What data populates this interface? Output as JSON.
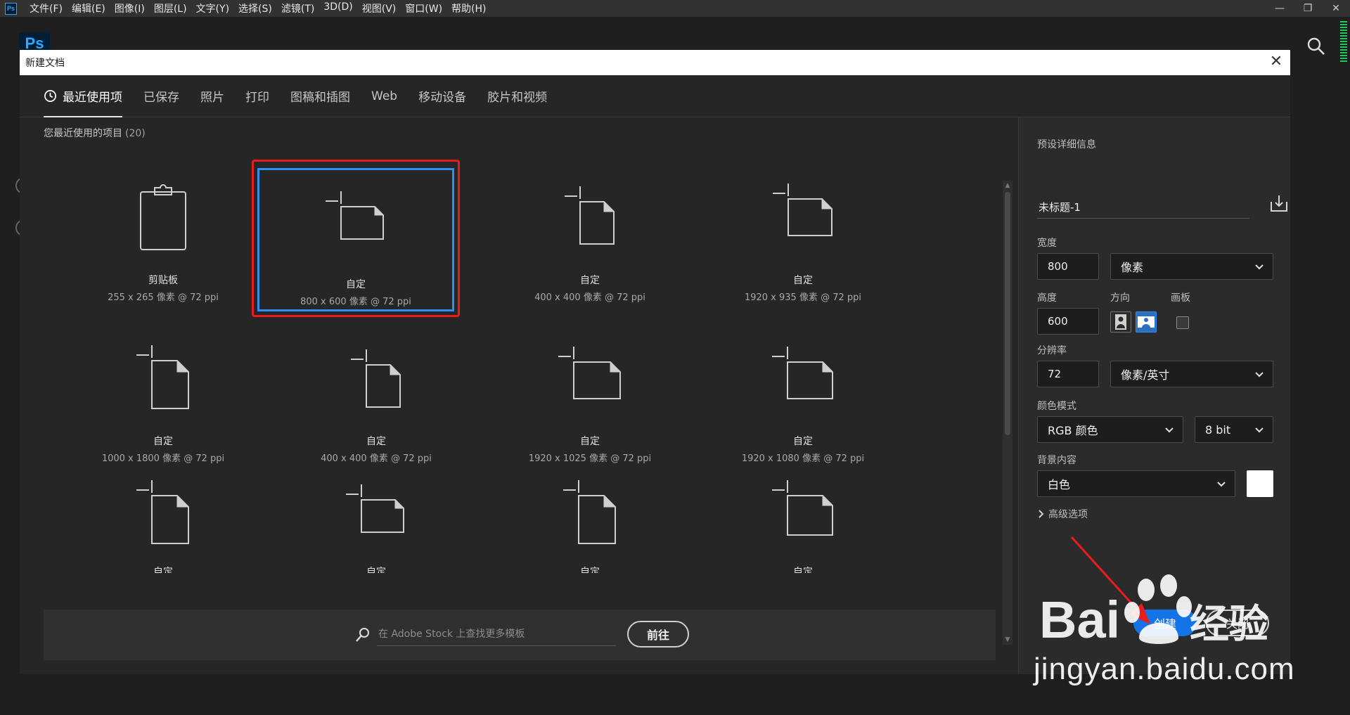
{
  "menubar": {
    "app_icon": "Ps",
    "items": [
      "文件(F)",
      "编辑(E)",
      "图像(I)",
      "图层(L)",
      "文字(Y)",
      "选择(S)",
      "滤镜(T)",
      "3D(D)",
      "视图(V)",
      "窗口(W)",
      "帮助(H)"
    ],
    "controls": [
      "minimize-icon",
      "restore-icon",
      "close-icon"
    ]
  },
  "app": {
    "logo": "Ps"
  },
  "dialog": {
    "title": "新建文档",
    "tabs": [
      "最近使用项",
      "已保存",
      "照片",
      "打印",
      "图稿和插图",
      "Web",
      "移动设备",
      "胶片和视频"
    ],
    "active_tab": 0,
    "recent": {
      "heading": "您最近使用的项目",
      "count": "(20)",
      "items": [
        {
          "name": "剪贴板",
          "dims": "255 x 265 像素 @ 72 ppi",
          "icon": "clipboard-icon"
        },
        {
          "name": "自定",
          "dims": "800 x 600 像素 @ 72 ppi",
          "icon": "landscape-doc-icon",
          "selected": true
        },
        {
          "name": "自定",
          "dims": "400 x 400 像素 @ 72 ppi",
          "icon": "portrait-doc-icon"
        },
        {
          "name": "自定",
          "dims": "1920 x 935 像素 @ 72 ppi",
          "icon": "landscape-doc-icon"
        },
        {
          "name": "自定",
          "dims": "1000 x 1800 像素 @ 72 ppi",
          "icon": "portrait-doc-icon"
        },
        {
          "name": "自定",
          "dims": "400 x 400 像素 @ 72 ppi",
          "icon": "portrait-doc-icon"
        },
        {
          "name": "自定",
          "dims": "1920 x 1025 像素 @ 72 ppi",
          "icon": "landscape-doc-icon"
        },
        {
          "name": "自定",
          "dims": "1920 x 1080 像素 @ 72 ppi",
          "icon": "landscape-doc-icon"
        },
        {
          "name": "自定",
          "dims": "",
          "icon": "portrait-doc-icon"
        },
        {
          "name": "自定",
          "dims": "",
          "icon": "landscape-doc-icon"
        },
        {
          "name": "自定",
          "dims": "",
          "icon": "portrait-doc-icon"
        },
        {
          "name": "自定",
          "dims": "",
          "icon": "landscape-doc-icon"
        }
      ]
    },
    "stock": {
      "placeholder": "在 Adobe Stock 上查找更多模板",
      "go_label": "前往"
    },
    "details": {
      "heading": "预设详细信息",
      "preset_name": "未标题-1",
      "width_label": "宽度",
      "width_value": "800",
      "width_unit": "像素",
      "height_label": "高度",
      "height_value": "600",
      "orientation_label": "方向",
      "artboard_label": "画板",
      "resolution_label": "分辨率",
      "resolution_value": "72",
      "resolution_unit": "像素/英寸",
      "color_mode_label": "颜色模式",
      "color_mode_value": "RGB 颜色",
      "bit_depth": "8 bit",
      "background_label": "背景内容",
      "background_value": "白色",
      "background_color": "#ffffff",
      "advanced_label": "高级选项",
      "create_label": "创建",
      "close_label": "关闭"
    }
  },
  "watermark": {
    "brand": "Bai",
    "brand_suffix": "经验",
    "url": "jingyan.baidu.com"
  },
  "colors": {
    "accent": "#1473e6",
    "highlight": "#e81d1d",
    "selection": "#2e8ff2"
  }
}
